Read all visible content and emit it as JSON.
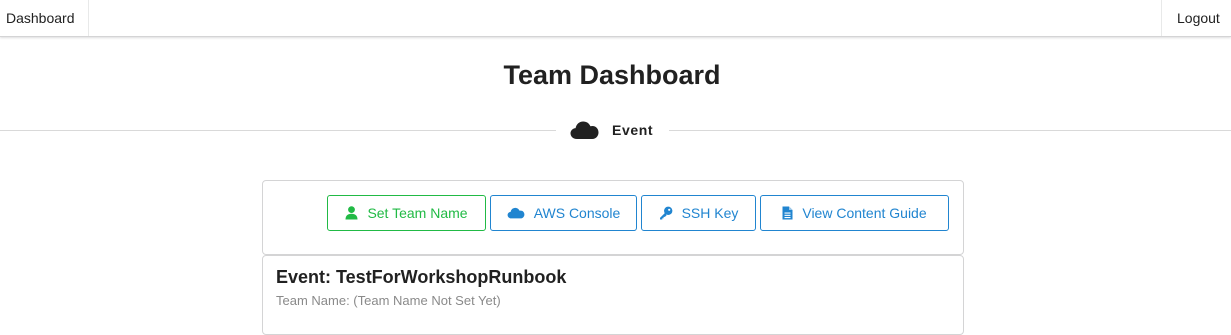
{
  "nav": {
    "dashboard_label": "Dashboard",
    "logout_label": "Logout"
  },
  "header": {
    "title": "Team Dashboard"
  },
  "divider": {
    "label": "Event",
    "icon": "cloud-icon"
  },
  "actions": [
    {
      "label": "Set Team Name",
      "icon": "user-icon",
      "color": "#21ba45"
    },
    {
      "label": "AWS Console",
      "icon": "cloud-icon",
      "color": "#2185d0"
    },
    {
      "label": "SSH Key",
      "icon": "key-icon",
      "color": "#2185d0"
    },
    {
      "label": "View Content Guide",
      "icon": "file-icon",
      "color": "#2185d0"
    }
  ],
  "event": {
    "title": "Event: TestForWorkshopRunbook",
    "team_name": "Team Name: (Team Name Not Set Yet)"
  }
}
